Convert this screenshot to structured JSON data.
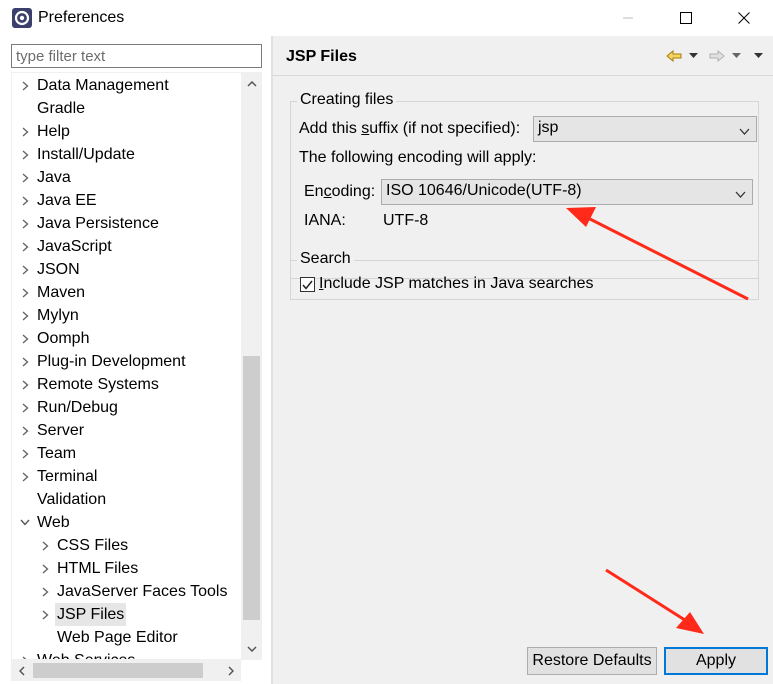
{
  "window": {
    "title": "Preferences"
  },
  "filter": {
    "placeholder": "type filter text"
  },
  "tree": {
    "items": [
      {
        "label": "Data Management",
        "expandable": true,
        "depth": 0
      },
      {
        "label": "Gradle",
        "expandable": false,
        "depth": 0
      },
      {
        "label": "Help",
        "expandable": true,
        "depth": 0
      },
      {
        "label": "Install/Update",
        "expandable": true,
        "depth": 0
      },
      {
        "label": "Java",
        "expandable": true,
        "depth": 0
      },
      {
        "label": "Java EE",
        "expandable": true,
        "depth": 0
      },
      {
        "label": "Java Persistence",
        "expandable": true,
        "depth": 0
      },
      {
        "label": "JavaScript",
        "expandable": true,
        "depth": 0
      },
      {
        "label": "JSON",
        "expandable": true,
        "depth": 0
      },
      {
        "label": "Maven",
        "expandable": true,
        "depth": 0
      },
      {
        "label": "Mylyn",
        "expandable": true,
        "depth": 0
      },
      {
        "label": "Oomph",
        "expandable": true,
        "depth": 0
      },
      {
        "label": "Plug-in Development",
        "expandable": true,
        "depth": 0
      },
      {
        "label": "Remote Systems",
        "expandable": true,
        "depth": 0
      },
      {
        "label": "Run/Debug",
        "expandable": true,
        "depth": 0
      },
      {
        "label": "Server",
        "expandable": true,
        "depth": 0
      },
      {
        "label": "Team",
        "expandable": true,
        "depth": 0
      },
      {
        "label": "Terminal",
        "expandable": true,
        "depth": 0
      },
      {
        "label": "Validation",
        "expandable": false,
        "depth": 0
      },
      {
        "label": "Web",
        "expandable": true,
        "expanded": true,
        "depth": 0
      },
      {
        "label": "CSS Files",
        "expandable": true,
        "depth": 1
      },
      {
        "label": "HTML Files",
        "expandable": true,
        "depth": 1
      },
      {
        "label": "JavaServer Faces Tools",
        "expandable": true,
        "depth": 1
      },
      {
        "label": "JSP Files",
        "expandable": true,
        "depth": 1,
        "selected": true
      },
      {
        "label": "Web Page Editor",
        "expandable": false,
        "depth": 1
      },
      {
        "label": "Web Services",
        "expandable": true,
        "depth": 0
      }
    ]
  },
  "page": {
    "title": "JSP Files",
    "creating_files": {
      "group_title": "Creating files",
      "suffix_label": "Add this suffix (if not specified):",
      "suffix_value": "jsp",
      "encoding_note": "The following encoding will apply:",
      "encoding_label": "Encoding:",
      "encoding_value": "ISO 10646/Unicode(UTF-8)",
      "iana_label": "IANA:",
      "iana_value": "UTF-8"
    },
    "search": {
      "group_title": "Search",
      "include_label": "Include JSP matches in Java searches",
      "include_checked": true
    },
    "buttons": {
      "restore": "Restore Defaults",
      "apply": "Apply"
    }
  },
  "colors": {
    "annotation_arrow": "#ff2a1a",
    "selection": "#e6e6e6",
    "focus_border": "#0078d7"
  }
}
